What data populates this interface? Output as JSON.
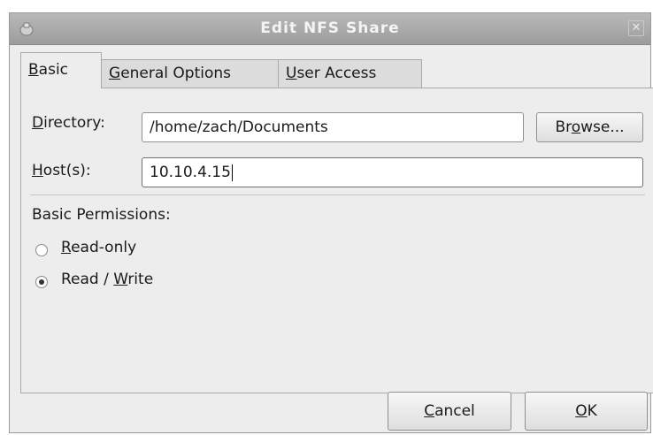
{
  "window": {
    "title": "Edit NFS Share",
    "close_glyph": "✕"
  },
  "tabs": [
    {
      "pre": "",
      "key": "B",
      "post": "asic"
    },
    {
      "pre": "",
      "key": "G",
      "post": "eneral Options"
    },
    {
      "pre": "",
      "key": "U",
      "post": "ser Access"
    }
  ],
  "directory": {
    "label_key": "D",
    "label_rest": "irectory:",
    "value": "/home/zach/Documents",
    "browse_pre": "Br",
    "browse_key": "o",
    "browse_post": "wse..."
  },
  "hosts": {
    "label_key": "H",
    "label_rest": "ost(s):",
    "value": "10.10.4.15"
  },
  "permissions": {
    "heading": "Basic Permissions:",
    "options": [
      {
        "pre": "",
        "key": "R",
        "post": "ead-only",
        "checked": false
      },
      {
        "pre": "Read / ",
        "key": "W",
        "post": "rite",
        "checked": true
      }
    ]
  },
  "buttons": {
    "cancel_key": "C",
    "cancel_rest": "ancel",
    "ok_key": "O",
    "ok_rest": "K"
  },
  "colors": {
    "titlebar": "#a8a8a8",
    "window_bg": "#ededed"
  },
  "icons": {
    "window": "nfs-share-window-icon",
    "close": "close-icon"
  }
}
